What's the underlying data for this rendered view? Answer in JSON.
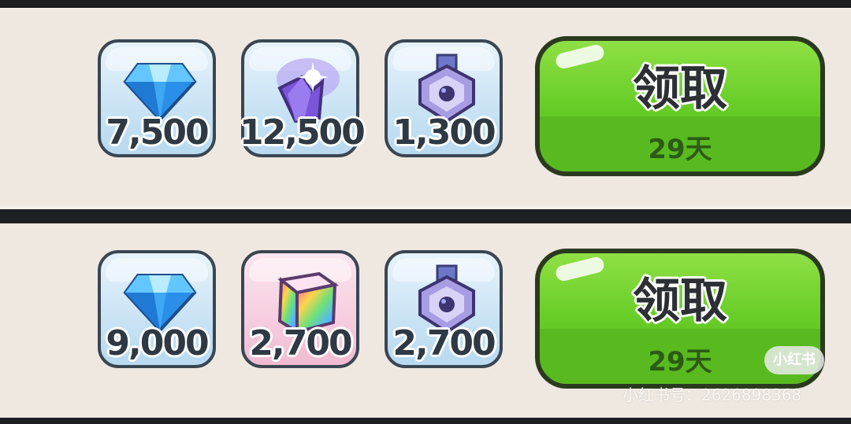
{
  "rows": [
    {
      "rewards": [
        {
          "icon": "diamond-icon",
          "quantity": "7,500"
        },
        {
          "icon": "crystal-shard-icon",
          "quantity": "12,500"
        },
        {
          "icon": "medal-emblem-icon",
          "quantity": "1,300"
        }
      ],
      "claim": {
        "label": "领取",
        "days": "29天"
      }
    },
    {
      "rewards": [
        {
          "icon": "diamond-icon",
          "quantity": "9,000"
        },
        {
          "icon": "rainbow-cube-icon",
          "quantity": "2,700"
        },
        {
          "icon": "medal-emblem-icon",
          "quantity": "2,700"
        }
      ],
      "claim": {
        "label": "领取",
        "days": "29天"
      }
    }
  ],
  "watermark": {
    "badge": "小红书",
    "text": "小红书号：2626898368"
  },
  "colors": {
    "claim_green": "#6bcf2a",
    "tile_blue": "#cbe4f5",
    "tile_pink": "#f6cfe0",
    "divider": "#1d1f22"
  }
}
